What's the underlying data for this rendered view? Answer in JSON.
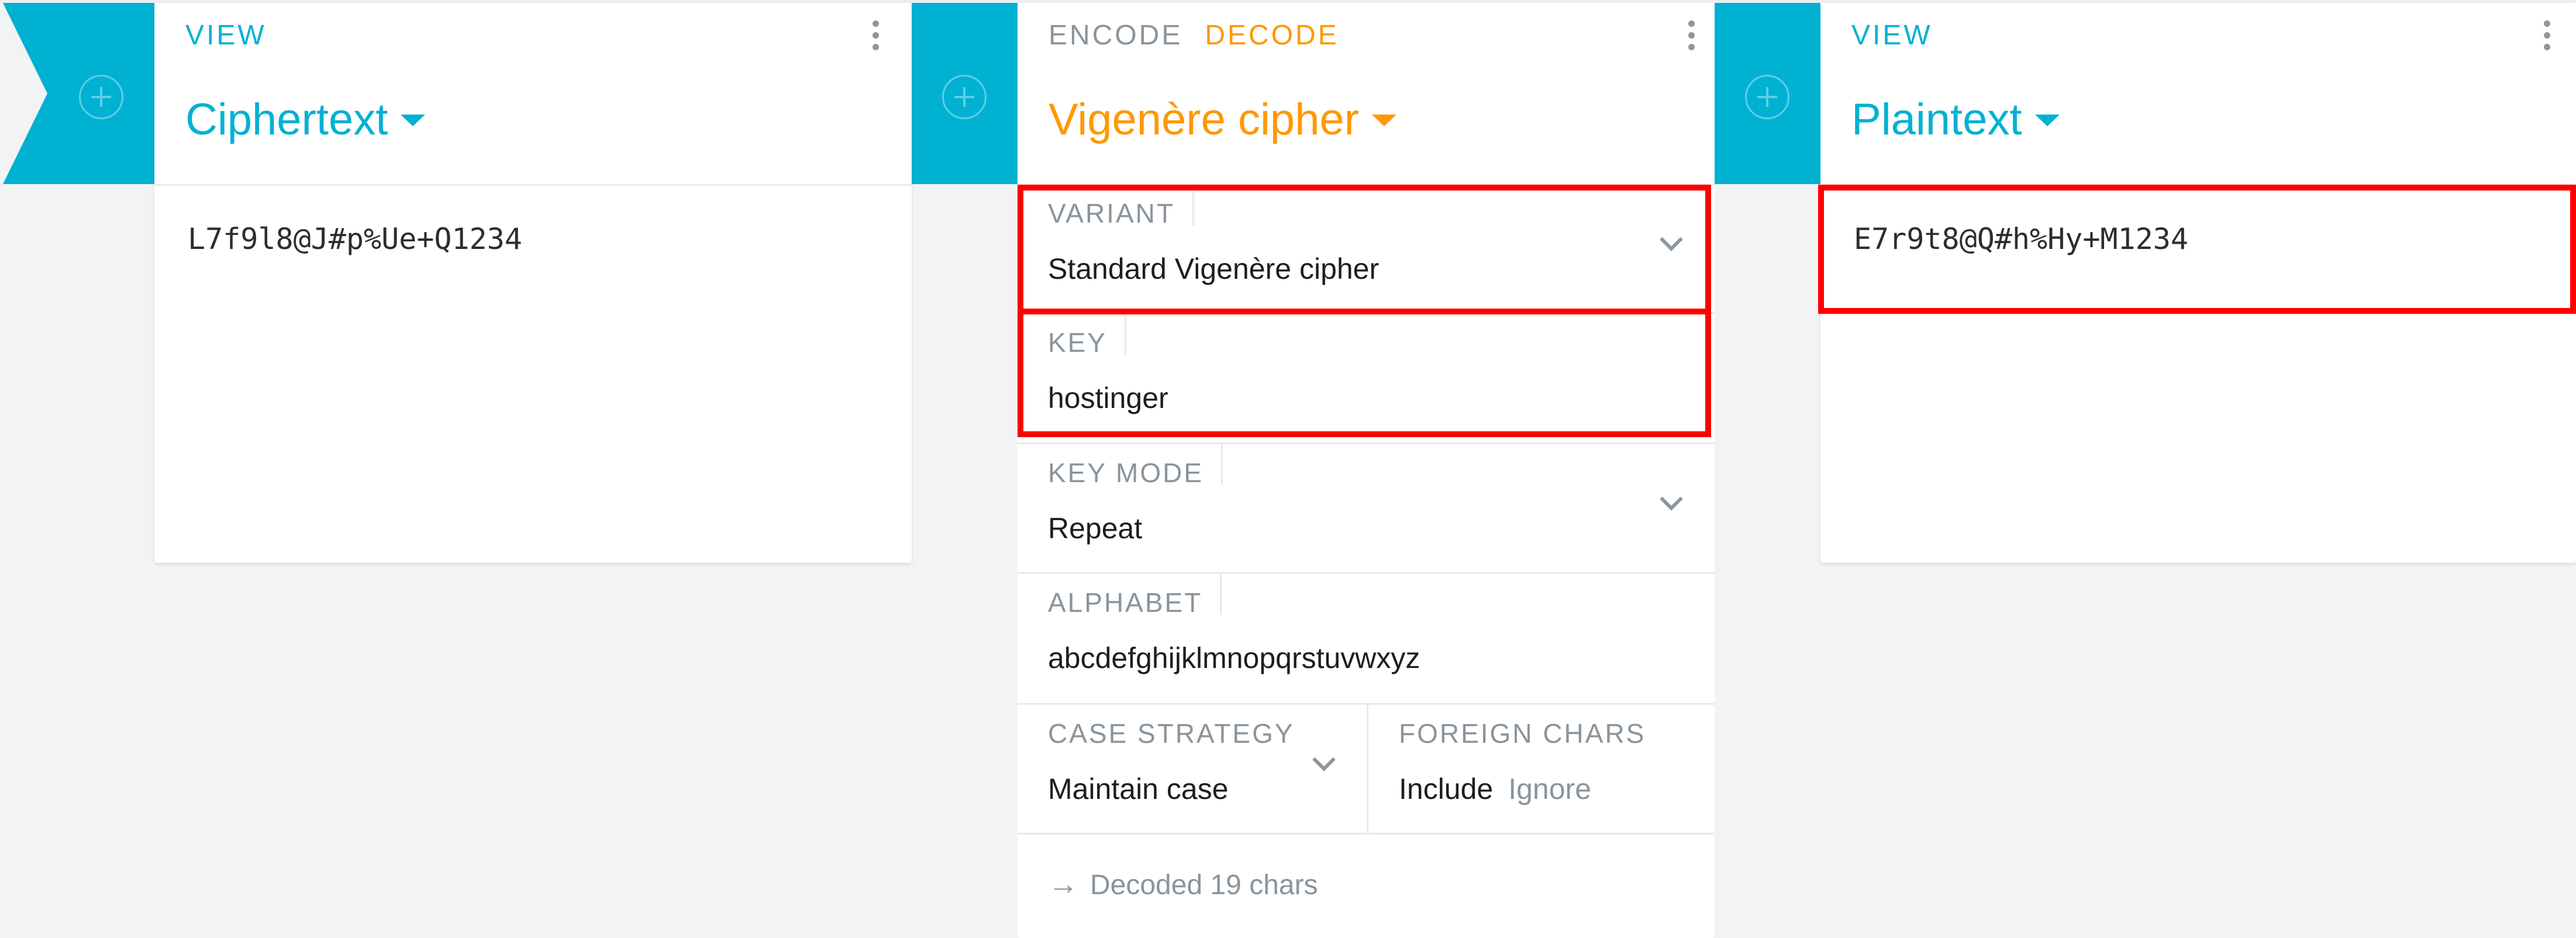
{
  "colors": {
    "teal": "#00b1d2",
    "orange": "#ff9800",
    "highlight": "#ff0000",
    "label_gray": "#8a949c",
    "background": "#f2f3f5"
  },
  "panels": [
    {
      "tabs": [
        {
          "label": "VIEW",
          "active": true
        }
      ],
      "title": "Ciphertext",
      "content": "L7f9l8@J#p%Ue+Q1234",
      "menu_icon": "more-vertical-icon",
      "add_icon": "add-circle-icon"
    },
    {
      "tabs": [
        {
          "label": "ENCODE",
          "active": false
        },
        {
          "label": "DECODE",
          "active": true
        }
      ],
      "title": "Vigenère cipher",
      "menu_icon": "more-vertical-icon",
      "add_icon": "add-circle-icon",
      "settings": {
        "variant": {
          "label": "VARIANT",
          "value": "Standard Vigenère cipher"
        },
        "key": {
          "label": "KEY",
          "value": "hostinger"
        },
        "key_mode": {
          "label": "KEY MODE",
          "value": "Repeat"
        },
        "alphabet": {
          "label": "ALPHABET",
          "value": "abcdefghijklmnopqrstuvwxyz"
        },
        "case_strategy": {
          "label": "CASE STRATEGY",
          "value": "Maintain case"
        },
        "foreign_chars": {
          "label": "FOREIGN CHARS",
          "options": [
            "Include",
            "Ignore"
          ],
          "selected": "Include"
        }
      },
      "status": {
        "icon": "arrow-right-icon",
        "text": "Decoded 19 chars"
      }
    },
    {
      "tabs": [
        {
          "label": "VIEW",
          "active": true
        }
      ],
      "title": "Plaintext",
      "content": "E7r9t8@Q#h%Hy+M1234",
      "menu_icon": "more-vertical-icon",
      "add_icon": "add-circle-icon"
    }
  ],
  "glyphs": {
    "arrow": "→"
  }
}
